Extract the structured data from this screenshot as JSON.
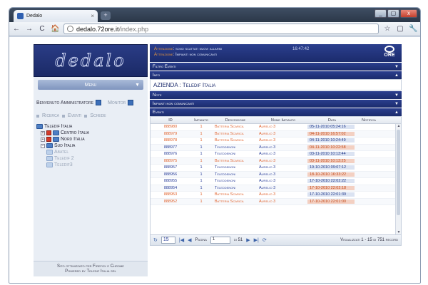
{
  "browser": {
    "tab_title": "Dedalo",
    "tab_close": "×",
    "new_tab": "+",
    "url_host": "dedalo.72ore.it",
    "url_path": "/index.php",
    "nav_back": "←",
    "nav_forward": "→",
    "nav_reload": "C",
    "nav_home": "🏠",
    "star": "☆",
    "page_menu": "▢",
    "tools_menu": "🔧",
    "win_min": "_",
    "win_max": "▢",
    "win_close": "x"
  },
  "sidebar": {
    "logo": "dedalo",
    "menu_label": "Menu",
    "menu_chevron": "▼",
    "welcome": "Benvenuto Amministratore",
    "monitor": "Monitor",
    "tabs": [
      "Ricerca",
      "Eventi",
      "Schede"
    ],
    "tree": {
      "root": "Teledif Italia",
      "children": [
        "Centro Italia",
        "Nord Italia",
        "Sud Italia"
      ],
      "leaves": [
        "Abatel",
        "Teledif 2",
        "Teledif3"
      ]
    },
    "footer_line1": "Sito ottimizzato per Firefox e Chrome",
    "footer_line2": "Powered by Teledif Italia srl"
  },
  "alerts": {
    "label1": "Attenzione",
    "text1": "sono scattati nuovi allarmi",
    "label2": "Attenzione",
    "text2": "Impianti non comunicanti",
    "time": "16:47:42",
    "brand": "ORE"
  },
  "panels": {
    "filtro": "Filtro Eventi",
    "info": "Info",
    "azienda": "AZIENDA : Teledif Italia",
    "note": "Note",
    "impianti": "Impianti non comunicanti",
    "eventi": "Eventi",
    "chev_down": "▼",
    "chev_up": "▲"
  },
  "grid": {
    "headers": [
      "ID",
      "Impianto",
      "Descrizione",
      "Nome Impianto",
      "Data",
      "Notifica"
    ],
    "rows": [
      {
        "id": "888980",
        "imp": "1",
        "desc": "Batteria Scarica",
        "nome": "Aurelio 3",
        "data": "05-11-2010 05:24:16",
        "color": "orange",
        "hi": false
      },
      {
        "id": "888979",
        "imp": "1",
        "desc": "Batteria Scarica",
        "nome": "Aurelio 3",
        "data": "04-11-2010 16:57:02",
        "color": "orange",
        "hi": true
      },
      {
        "id": "888978",
        "imp": "1",
        "desc": "Batteria Scarica",
        "nome": "Aurelio 3",
        "data": "04-11-2010 10:24:49",
        "color": "orange",
        "hi": false
      },
      {
        "id": "888977",
        "imp": "1",
        "desc": "Teleddenoni",
        "nome": "Aurelio 3",
        "data": "04-11-2010 10:22:58",
        "color": "blue",
        "hi": true
      },
      {
        "id": "888976",
        "imp": "1",
        "desc": "Teleddenoni",
        "nome": "Aurelio 3",
        "data": "03-11-2010 10:13:44",
        "color": "blue",
        "hi": false
      },
      {
        "id": "888975",
        "imp": "1",
        "desc": "Batteria Scarica",
        "nome": "Aurelio 3",
        "data": "03-11-2010 10:13:25",
        "color": "orange",
        "hi": true
      },
      {
        "id": "888957",
        "imp": "1",
        "desc": "Teleddenoni",
        "nome": "Aurelio 3",
        "data": "19-10-2010 09:07:12",
        "color": "blue",
        "hi": false
      },
      {
        "id": "888956",
        "imp": "1",
        "desc": "Teleddenoni",
        "nome": "Aurelio 3",
        "data": "18-10-2010 16:33:22",
        "color": "blue",
        "hi": true
      },
      {
        "id": "888955",
        "imp": "1",
        "desc": "Teleddenoni",
        "nome": "Aurelio 3",
        "data": "17-10-2010 22:02:22",
        "color": "blue",
        "hi": false
      },
      {
        "id": "888954",
        "imp": "1",
        "desc": "Teleddenoni",
        "nome": "Aurelio 3",
        "data": "17-10-2010 22:02:18",
        "color": "blue",
        "hi": true
      },
      {
        "id": "888953",
        "imp": "1",
        "desc": "Batteria Scarica",
        "nome": "Aurelio 3",
        "data": "17-10-2010 22:01:39",
        "color": "orange",
        "hi": false
      },
      {
        "id": "888952",
        "imp": "1",
        "desc": "Batteria Scarica",
        "nome": "Aurelio 3",
        "data": "17-10-2010 22:01:00",
        "color": "orange",
        "hi": true
      }
    ]
  },
  "pager": {
    "refresh": "↻",
    "page_size": "15",
    "first": "|◀",
    "prev": "◀",
    "page_label": "Pagina",
    "page_value": "1",
    "of_label": "di 51",
    "next": "▶",
    "last": "▶|",
    "reload": "⟳",
    "display": "Visualizzati 1 - 15 di 751 record"
  },
  "colors": {
    "header_navy": "#1b2b6c",
    "accent_orange": "#e0602a",
    "row_blue": "#2a3f9a"
  }
}
